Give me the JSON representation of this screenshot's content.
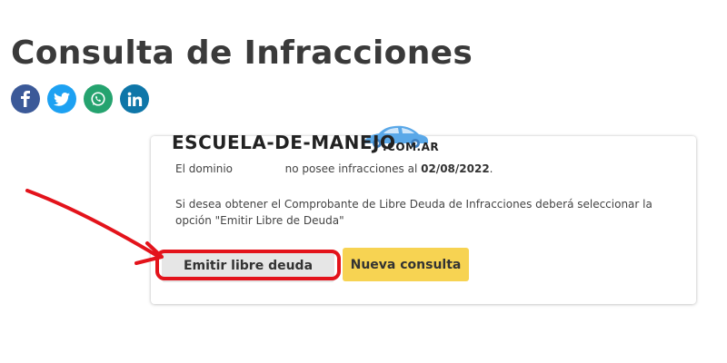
{
  "page": {
    "title": "Consulta de Infracciones"
  },
  "social": [
    {
      "name": "facebook",
      "icon": "facebook-icon",
      "color": "#3b5998"
    },
    {
      "name": "twitter",
      "icon": "twitter-icon",
      "color": "#1da1f2"
    },
    {
      "name": "whatsapp",
      "icon": "whatsapp-icon",
      "color": "#25a36f"
    },
    {
      "name": "linkedin",
      "icon": "linkedin-icon",
      "color": "#0e76a8"
    }
  ],
  "watermark": {
    "text": "ESCUELA-DE-MANEJO",
    "domain": ".COM.AR",
    "icon": "car-icon",
    "color": "#5aa8e8"
  },
  "result": {
    "line1_prefix": "El dominio",
    "line1_suffix": "no posee infracciones al",
    "date": "02/08/2022",
    "line1_end": ".",
    "line2": "Si desea obtener el Comprobante de Libre Deuda de Infracciones deberá seleccionar la",
    "line3": "opción \"Emitir Libre de Deuda\""
  },
  "buttons": {
    "emitir_label": "Emitir libre deuda",
    "nueva_label": "Nueva consulta"
  },
  "colors": {
    "accent_yellow": "#f7d352",
    "button_gray": "#e6e6e6",
    "annotation_red": "#e3131b"
  }
}
